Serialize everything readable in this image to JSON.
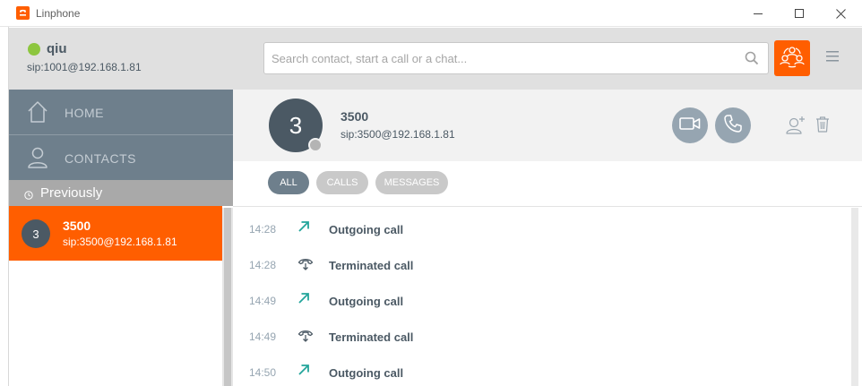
{
  "window": {
    "title": "Linphone",
    "minimize_icon": "minimize-icon",
    "maximize_icon": "maximize-icon",
    "close_icon": "close-icon"
  },
  "account": {
    "username": "qiu",
    "sip": "sip:1001@192.168.1.81",
    "presence_color": "#8dc63f"
  },
  "search": {
    "placeholder": "Search contact, start a call or a chat...",
    "value": ""
  },
  "nav": {
    "items": [
      {
        "label": "HOME",
        "icon": "home-icon"
      },
      {
        "label": "CONTACTS",
        "icon": "contacts-icon"
      }
    ],
    "section_label": "Previously"
  },
  "entries": [
    {
      "avatar": "3",
      "name": "3500",
      "sip": "sip:3500@192.168.1.81"
    }
  ],
  "contact": {
    "avatar": "3",
    "name": "3500",
    "sip": "sip:3500@192.168.1.81"
  },
  "filters": [
    {
      "label": "ALL",
      "active": true
    },
    {
      "label": "CALLS",
      "active": false
    },
    {
      "label": "MESSAGES",
      "active": false
    }
  ],
  "history": [
    {
      "time": "14:28",
      "event": "Outgoing call",
      "icon": "outgoing-call-icon"
    },
    {
      "time": "14:28",
      "event": "Terminated call",
      "icon": "terminated-call-icon"
    },
    {
      "time": "14:49",
      "event": "Outgoing call",
      "icon": "outgoing-call-icon"
    },
    {
      "time": "14:49",
      "event": "Terminated call",
      "icon": "terminated-call-icon"
    },
    {
      "time": "14:50",
      "event": "Outgoing call",
      "icon": "outgoing-call-icon"
    }
  ],
  "colors": {
    "accent": "#ff5e00",
    "nav_bg": "#6e7f8c",
    "text_dark": "#4b5964",
    "outgoing_arrow": "#23a59b"
  }
}
